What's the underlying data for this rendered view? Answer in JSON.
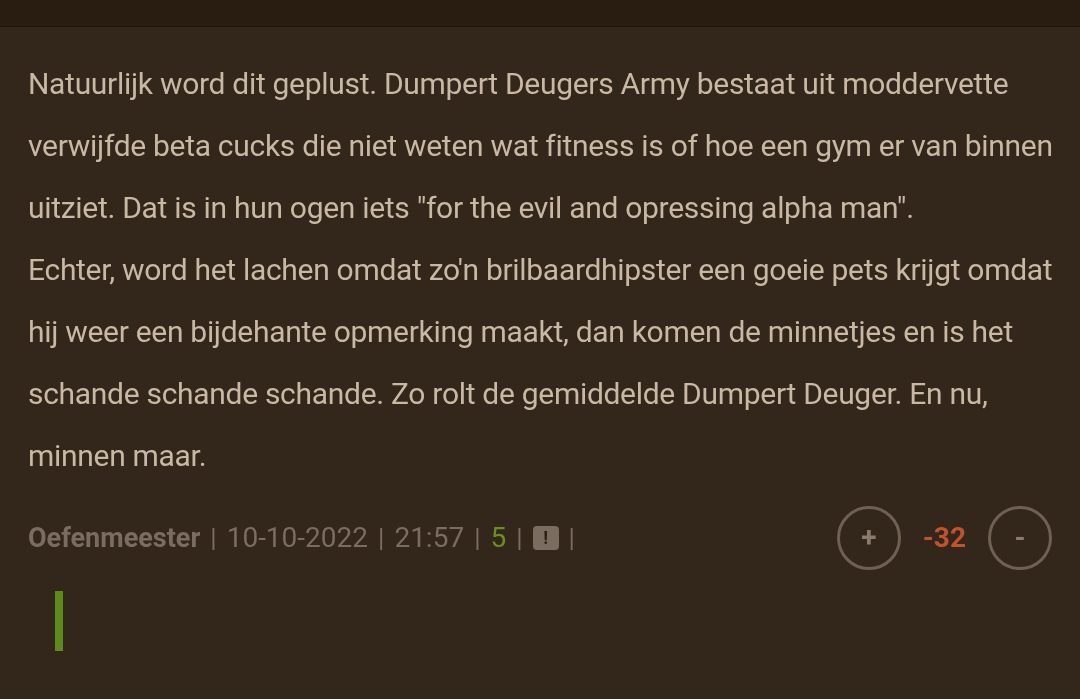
{
  "comment": {
    "paragraphs": [
      "Natuurlijk word dit geplust. Dumpert Deugers Army bestaat uit moddervette verwijfde beta cucks die niet weten wat fitness is of hoe een gym er van binnen uitziet. Dat is in hun ogen iets \"for the evil and opressing alpha man\".",
      "Echter, word het lachen omdat zo'n brilbaardhipster een goeie pets krijgt omdat hij weer een bijdehante opmerking maakt, dan komen de minnetjes en is het schande schande schande. Zo rolt de gemiddelde Dumpert Deuger. En nu, minnen maar."
    ],
    "author": "Oefenmeester",
    "date": "10-10-2022",
    "time": "21:57",
    "replies": "5",
    "report": "!",
    "separator": "|",
    "vote": {
      "up": "+",
      "score": "-32",
      "down": "-"
    }
  }
}
